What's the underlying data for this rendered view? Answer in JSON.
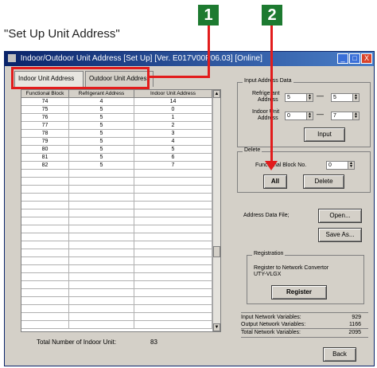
{
  "caption": "\"Set Up Unit Address\"",
  "callouts": [
    "1",
    "2"
  ],
  "window": {
    "title": "Indoor/Outdoor Unit Address  [Set Up] [Ver. E017V00P06.03] [Online]",
    "min_label": "_",
    "max_label": "□",
    "close_label": "X"
  },
  "tabs": {
    "indoor": "Indoor Unit Address",
    "outdoor": "Outdoor Unit Address"
  },
  "table": {
    "headers": [
      "Functional Block",
      "Refrigerant Address",
      "Indoor Unit Address"
    ],
    "rows": [
      [
        "74",
        "4",
        "14"
      ],
      [
        "75",
        "5",
        "0"
      ],
      [
        "76",
        "5",
        "1"
      ],
      [
        "77",
        "5",
        "2"
      ],
      [
        "78",
        "5",
        "3"
      ],
      [
        "79",
        "5",
        "4"
      ],
      [
        "80",
        "5",
        "5"
      ],
      [
        "81",
        "5",
        "6"
      ],
      [
        "82",
        "5",
        "7"
      ]
    ]
  },
  "totals": {
    "label": "Total Number of Indoor Unit:",
    "value": "83"
  },
  "input_address": {
    "title": "Input Address Data",
    "refrigerant_label_1": "Refrigerant",
    "refrigerant_label_2": "Address",
    "refrigerant_from": "5",
    "refrigerant_to": "5",
    "indoor_label_1": "Indoor Unit",
    "indoor_label_2": "Address",
    "indoor_from": "0",
    "indoor_to": "7",
    "dash": "—",
    "input_button": "Input"
  },
  "delete": {
    "title": "Delete",
    "fb_label": "Functional Block No.",
    "fb_value": "0",
    "all_button": "All",
    "delete_button": "Delete"
  },
  "file": {
    "label": "Address Data File;",
    "open_button": "Open...",
    "save_button": "Save As..."
  },
  "registration": {
    "title": "Registration",
    "text_1": "Register to Network Convertor",
    "text_2": "UTY-VLGX",
    "button": "Register"
  },
  "stats": [
    {
      "label": "Input Network Variables:",
      "value": "929"
    },
    {
      "label": "Output Network Variables:",
      "value": "1166"
    },
    {
      "label": "Total Network Variables:",
      "value": "2095"
    }
  ],
  "back_button": "Back",
  "colors": {
    "callout": "#1d7a30",
    "highlight": "#e21c1c",
    "titlebar": "#0a246a"
  }
}
